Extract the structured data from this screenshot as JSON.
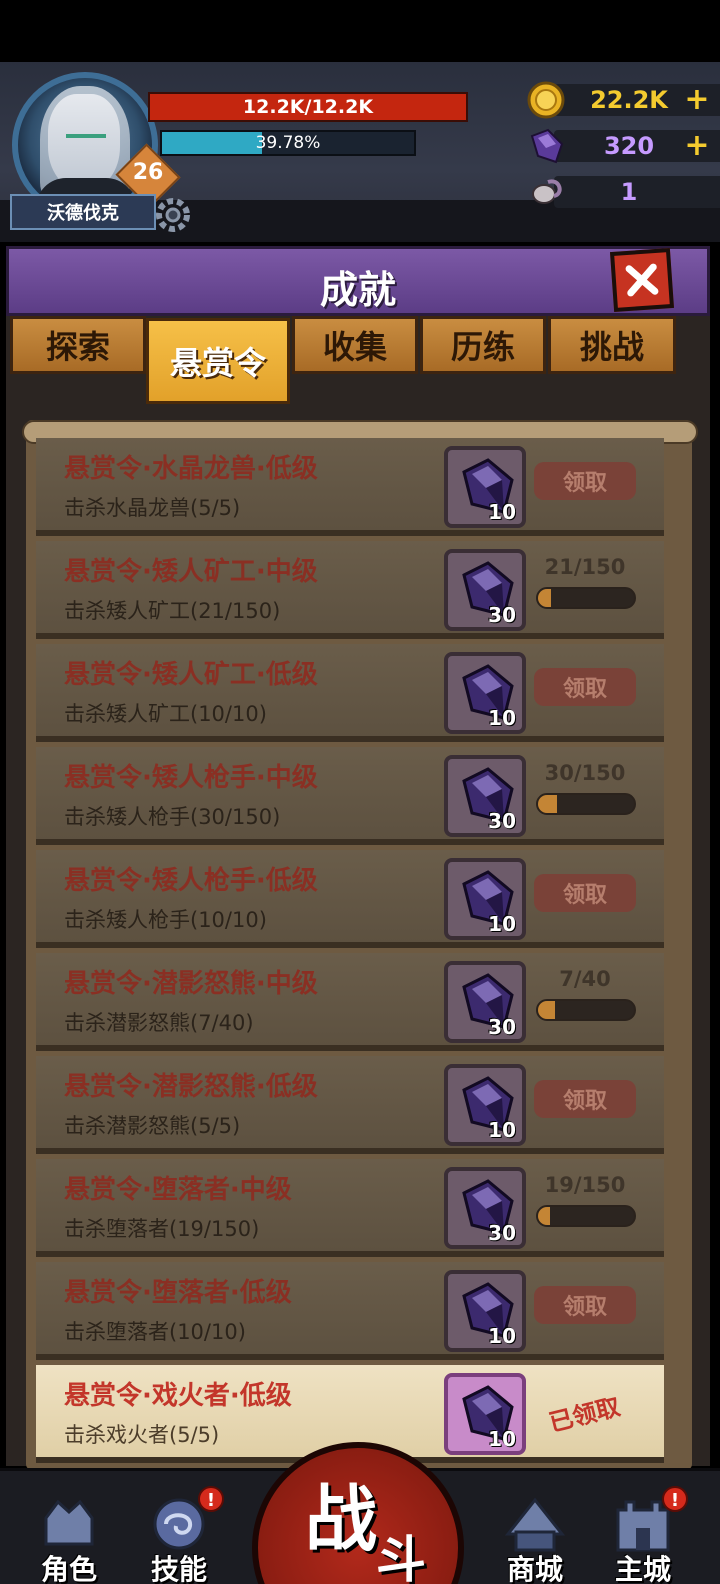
{
  "player": {
    "name": "沃德伐克",
    "level": "26",
    "hp_text": "12.2K/12.2K",
    "exp_text": "39.78%",
    "exp_fraction": 0.3978
  },
  "resources": {
    "gold": "22.2K",
    "crystal": "320",
    "token": "1",
    "plus": "+"
  },
  "panel": {
    "title": "成就",
    "tabs": [
      "探索",
      "悬赏令",
      "收集",
      "历练",
      "挑战"
    ],
    "active_tab": 1
  },
  "achievements": [
    {
      "title": "悬赏令·水晶龙兽·低级",
      "desc": "击杀水晶龙兽(5/5)",
      "reward": "10",
      "state": "claimable",
      "button": "领取"
    },
    {
      "title": "悬赏令·矮人矿工·中级",
      "desc": "击杀矮人矿工(21/150)",
      "reward": "30",
      "state": "progress",
      "progress_text": "21/150",
      "progress": 0.14
    },
    {
      "title": "悬赏令·矮人矿工·低级",
      "desc": "击杀矮人矿工(10/10)",
      "reward": "10",
      "state": "claimable",
      "button": "领取"
    },
    {
      "title": "悬赏令·矮人枪手·中级",
      "desc": "击杀矮人枪手(30/150)",
      "reward": "30",
      "state": "progress",
      "progress_text": "30/150",
      "progress": 0.2
    },
    {
      "title": "悬赏令·矮人枪手·低级",
      "desc": "击杀矮人枪手(10/10)",
      "reward": "10",
      "state": "claimable",
      "button": "领取"
    },
    {
      "title": "悬赏令·潜影怒熊·中级",
      "desc": "击杀潜影怒熊(7/40)",
      "reward": "30",
      "state": "progress",
      "progress_text": "7/40",
      "progress": 0.175
    },
    {
      "title": "悬赏令·潜影怒熊·低级",
      "desc": "击杀潜影怒熊(5/5)",
      "reward": "10",
      "state": "claimable",
      "button": "领取"
    },
    {
      "title": "悬赏令·堕落者·中级",
      "desc": "击杀堕落者(19/150)",
      "reward": "30",
      "state": "progress",
      "progress_text": "19/150",
      "progress": 0.127
    },
    {
      "title": "悬赏令·堕落者·低级",
      "desc": "击杀堕落者(10/10)",
      "reward": "10",
      "state": "claimable",
      "button": "领取"
    },
    {
      "title": "悬赏令·戏火者·低级",
      "desc": "击杀戏火者(5/5)",
      "reward": "10",
      "state": "claimed",
      "stamp": "已领取"
    }
  ],
  "nav": {
    "role": "角色",
    "skill": "技能",
    "battle_1": "战",
    "battle_2": "斗",
    "shop": "商城",
    "city": "主城",
    "alert": "!"
  },
  "colors": {
    "hp": "#c4260f",
    "exp": "#2fa9c4",
    "gold_plus": "#f4cb2f",
    "title_bar": "#6a4a96",
    "tab_active": "#f0b23a"
  }
}
